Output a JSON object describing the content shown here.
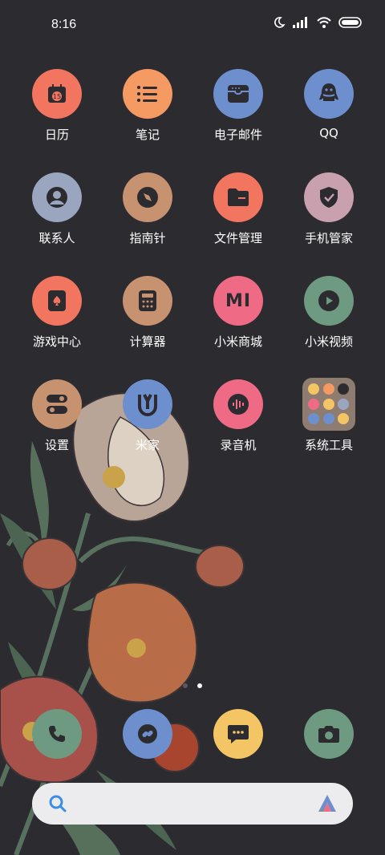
{
  "status_bar": {
    "time": "8:16"
  },
  "apps": [
    {
      "label": "日历",
      "icon": "calendar-icon",
      "color": "#f2765f",
      "calendar_day": "15"
    },
    {
      "label": "笔记",
      "icon": "notes-icon",
      "color": "#f49a62"
    },
    {
      "label": "电子邮件",
      "icon": "mail-icon",
      "color": "#6e8fce"
    },
    {
      "label": "QQ",
      "icon": "qq-icon",
      "color": "#6e8fce"
    },
    {
      "label": "联系人",
      "icon": "contacts-icon",
      "color": "#9aa6c0"
    },
    {
      "label": "指南针",
      "icon": "compass-icon",
      "color": "#c7926f"
    },
    {
      "label": "文件管理",
      "icon": "folder-file-icon",
      "color": "#f2765f"
    },
    {
      "label": "手机管家",
      "icon": "shield-icon",
      "color": "#c8a0ae"
    },
    {
      "label": "游戏中心",
      "icon": "game-icon",
      "color": "#f2765f"
    },
    {
      "label": "计算器",
      "icon": "calculator-icon",
      "color": "#c7926f"
    },
    {
      "label": "小米商城",
      "icon": "mi-store-icon",
      "color": "#ef6b85",
      "mi_text": "MI"
    },
    {
      "label": "小米视频",
      "icon": "video-play-icon",
      "color": "#6d9a80"
    },
    {
      "label": "设置",
      "icon": "settings-toggle-icon",
      "color": "#c7926f"
    },
    {
      "label": "米家",
      "icon": "mijia-icon",
      "color": "#6e8fce"
    },
    {
      "label": "录音机",
      "icon": "recorder-icon",
      "color": "#ef6b85"
    },
    {
      "label": "系统工具",
      "icon": "folder-icon",
      "color": "#8d7c6f"
    }
  ],
  "dock": [
    {
      "icon": "phone-icon",
      "color": "#6d9a80"
    },
    {
      "icon": "link-icon",
      "color": "#6e8fce"
    },
    {
      "icon": "message-icon",
      "color": "#f4c565"
    },
    {
      "icon": "camera-icon",
      "color": "#6d9a80"
    }
  ],
  "search_bar": {
    "accent": "#3a8ee6"
  },
  "page_indicator": {
    "pages": 2,
    "current": 2
  }
}
